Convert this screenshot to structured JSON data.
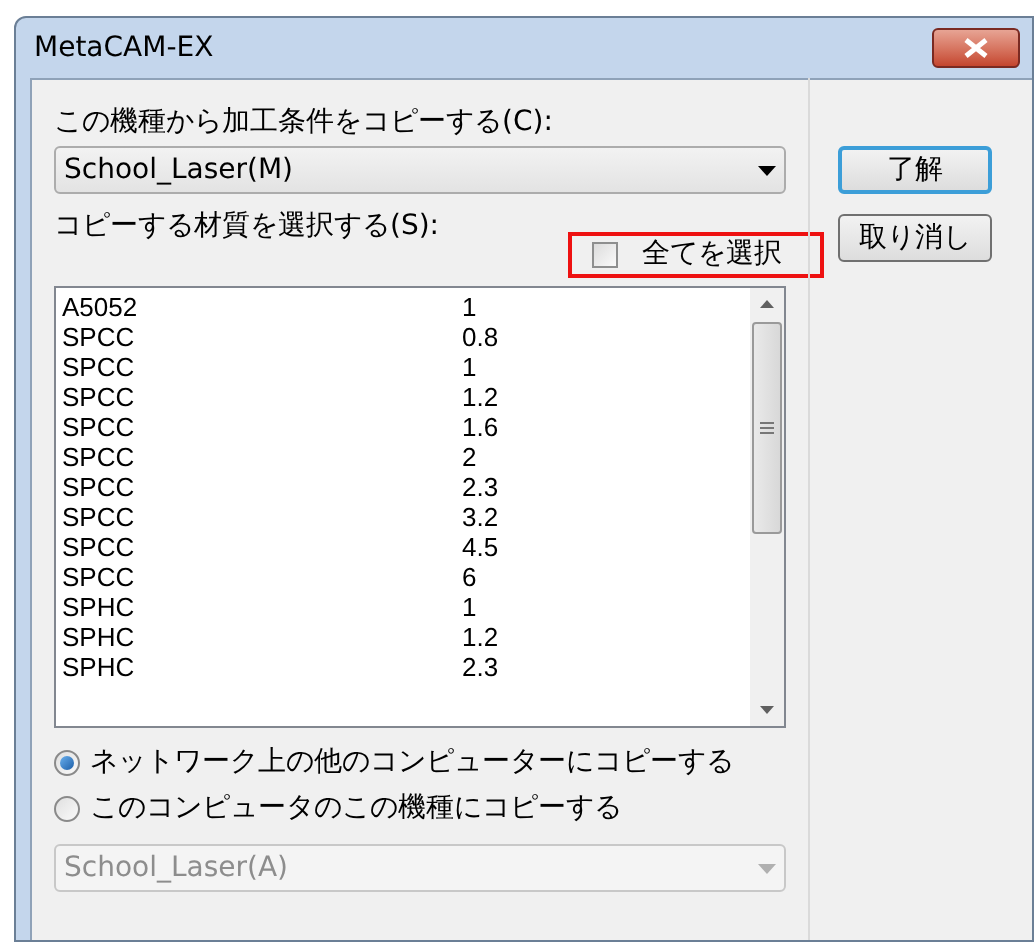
{
  "window": {
    "title": "MetaCAM-EX"
  },
  "source": {
    "label": "この機種から加工条件をコピーする(C):",
    "value": "School_Laser(M)"
  },
  "materials": {
    "label": "コピーする材質を選択する(S):",
    "select_all": {
      "label": "全てを選択",
      "checked": false,
      "highlighted": true
    },
    "rows": [
      {
        "material": "A5052",
        "thickness": "1"
      },
      {
        "material": "SPCC",
        "thickness": "0.8"
      },
      {
        "material": "SPCC",
        "thickness": "1"
      },
      {
        "material": "SPCC",
        "thickness": "1.2"
      },
      {
        "material": "SPCC",
        "thickness": "1.6"
      },
      {
        "material": "SPCC",
        "thickness": "2"
      },
      {
        "material": "SPCC",
        "thickness": "2.3"
      },
      {
        "material": "SPCC",
        "thickness": "3.2"
      },
      {
        "material": "SPCC",
        "thickness": "4.5"
      },
      {
        "material": "SPCC",
        "thickness": "6"
      },
      {
        "material": "SPHC",
        "thickness": "1"
      },
      {
        "material": "SPHC",
        "thickness": "1.2"
      },
      {
        "material": "SPHC",
        "thickness": "2.3"
      }
    ]
  },
  "destinations": [
    {
      "label": "ネットワーク上の他のコンピューターにコピーする",
      "selected": true
    },
    {
      "label": "このコンピュータのこの機種にコピーする",
      "selected": false
    }
  ],
  "target": {
    "value": "School_Laser(A)",
    "disabled": true
  },
  "buttons": [
    "了解",
    "取り消し"
  ]
}
